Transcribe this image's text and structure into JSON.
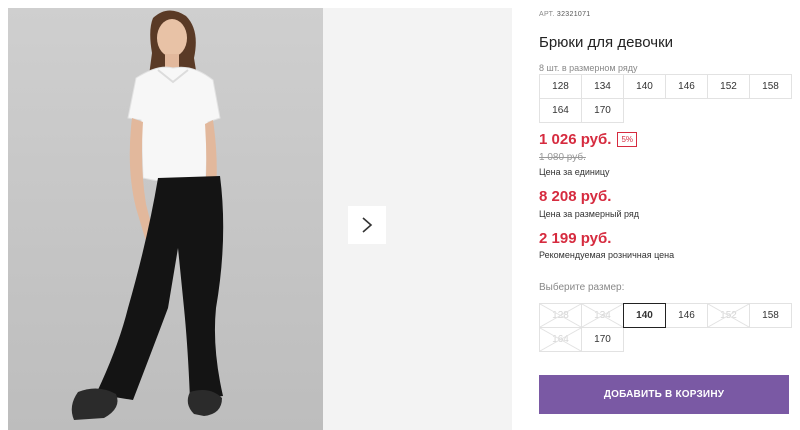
{
  "product": {
    "article_label": "АРТ.",
    "article_number": "32321071",
    "title": "Брюки для девочки"
  },
  "size_range": {
    "label": "8 шт. в размерном ряду",
    "sizes": [
      "128",
      "134",
      "140",
      "146",
      "152",
      "158",
      "164",
      "170"
    ]
  },
  "pricing": {
    "price": "1 026 руб.",
    "discount": "5%",
    "old_price": "1 080 руб.",
    "unit_caption": "Цена за единицу",
    "range_price": "8 208 руб.",
    "range_caption": "Цена за размерный ряд",
    "retail_price": "2 199 руб.",
    "retail_caption": "Рекомендуемая розничная цена"
  },
  "size_select": {
    "label": "Выберите размер:",
    "options": [
      {
        "size": "128",
        "available": false
      },
      {
        "size": "134",
        "available": false
      },
      {
        "size": "140",
        "available": true,
        "selected": true
      },
      {
        "size": "146",
        "available": true
      },
      {
        "size": "152",
        "available": false
      },
      {
        "size": "158",
        "available": true
      },
      {
        "size": "164",
        "available": false
      },
      {
        "size": "170",
        "available": true
      }
    ]
  },
  "cart_button": {
    "label": "ДОБАВИТЬ В КОРЗИНУ"
  },
  "gallery": {
    "next_icon": "chevron-right-icon"
  },
  "colors": {
    "price": "#d62b3f",
    "button": "#7a59a4"
  }
}
